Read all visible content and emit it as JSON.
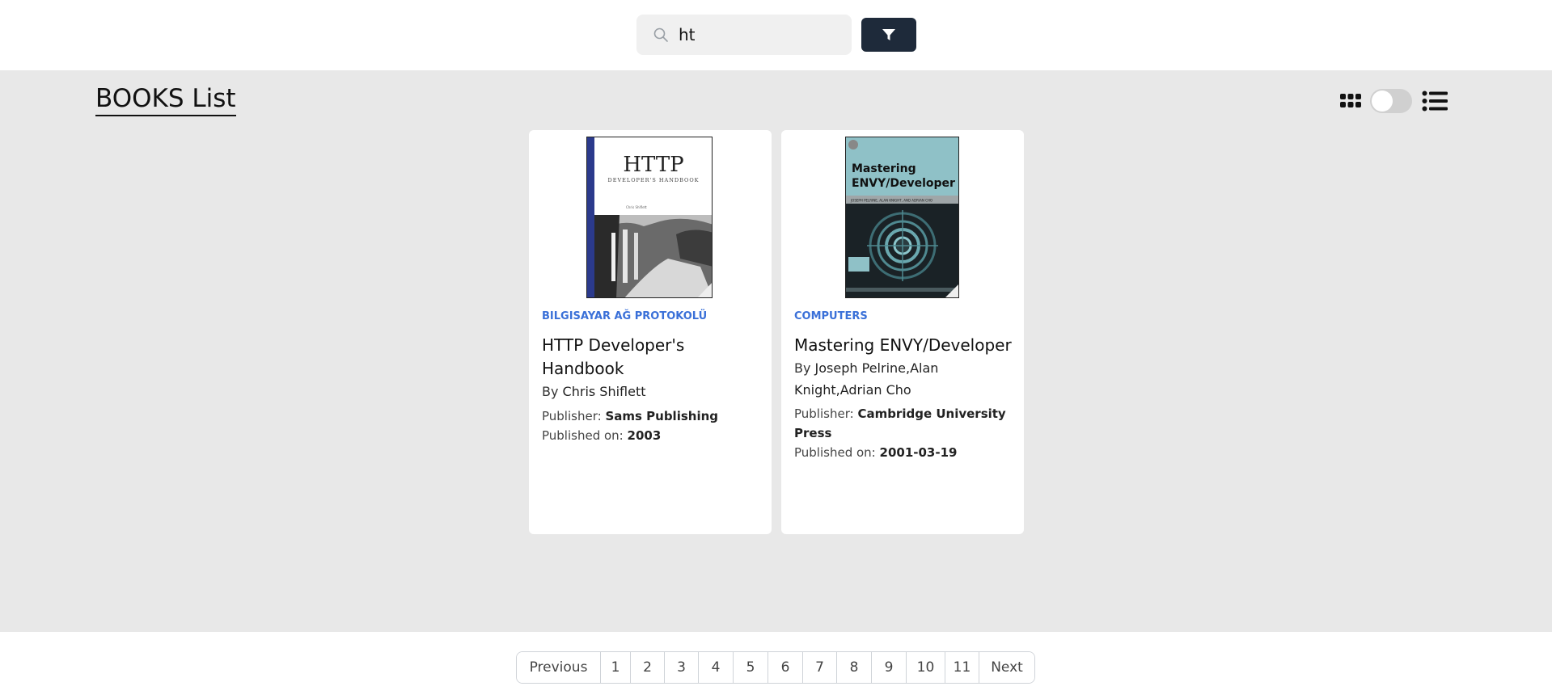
{
  "search": {
    "value": "ht",
    "placeholder": ""
  },
  "header": {
    "title": "BOOKS List"
  },
  "books": [
    {
      "category": "BILGISAYAR AĞ PROTOKOLÜ",
      "title": "HTTP Developer's Handbook",
      "by_label": "By",
      "author": "Chris Shiflett",
      "publisher_label": "Publisher:",
      "publisher": "Sams Publishing",
      "published_label": "Published on:",
      "published": "2003",
      "cover": {
        "title": "HTTP",
        "subtitle": "DEVELOPER'S HANDBOOK",
        "author": "Chris Shiflett"
      }
    },
    {
      "category": "COMPUTERS",
      "title": "Mastering ENVY/Developer",
      "by_label": "By",
      "author": "Joseph Pelrine,Alan Knight,Adrian Cho",
      "publisher_label": "Publisher:",
      "publisher": "Cambridge University Press",
      "published_label": "Published on:",
      "published": "2001-03-19",
      "cover": {
        "title_line1": "Mastering",
        "title_line2": "ENVY/Developer",
        "authors": "JOSEPH PELRINE, ALAN KNIGHT, AND ADRIAN CHO"
      }
    }
  ],
  "pagination": {
    "previous": "Previous",
    "pages": [
      "1",
      "2",
      "3",
      "4",
      "5",
      "6",
      "7",
      "8",
      "9",
      "10",
      "11"
    ],
    "next": "Next"
  },
  "colors": {
    "accent": "#3a70d8",
    "filter_button": "#1e2a3a",
    "background": "#e8e8e8"
  },
  "icons": [
    "search-icon",
    "filter-icon",
    "grid-view-icon",
    "list-view-icon"
  ]
}
